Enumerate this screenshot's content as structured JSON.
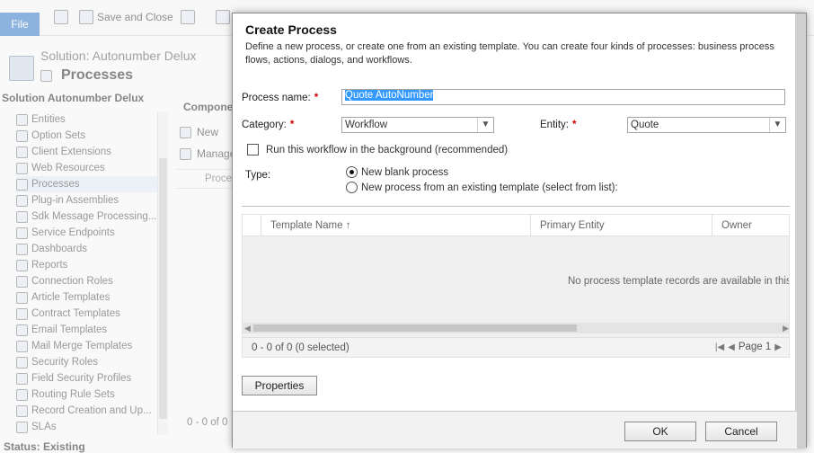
{
  "ribbon": {
    "file_label": "File",
    "save_close_label": "Save and Close"
  },
  "solution": {
    "title": "Solution: Autonumber Delux",
    "page_title": "Processes",
    "nav_heading": "Solution Autonumber Delux",
    "nav_items": [
      {
        "label": "Entities",
        "icon": "entities-icon"
      },
      {
        "label": "Option Sets",
        "icon": "option-sets-icon"
      },
      {
        "label": "Client Extensions",
        "icon": "client-extensions-icon"
      },
      {
        "label": "Web Resources",
        "icon": "web-resources-icon"
      },
      {
        "label": "Processes",
        "icon": "processes-icon",
        "selected": true
      },
      {
        "label": "Plug-in Assemblies",
        "icon": "plugin-icon"
      },
      {
        "label": "Sdk Message Processing...",
        "icon": "sdk-message-icon"
      },
      {
        "label": "Service Endpoints",
        "icon": "service-endpoint-icon"
      },
      {
        "label": "Dashboards",
        "icon": "dashboards-icon"
      },
      {
        "label": "Reports",
        "icon": "reports-icon"
      },
      {
        "label": "Connection Roles",
        "icon": "connection-roles-icon"
      },
      {
        "label": "Article Templates",
        "icon": "article-templates-icon"
      },
      {
        "label": "Contract Templates",
        "icon": "contract-templates-icon"
      },
      {
        "label": "Email Templates",
        "icon": "email-templates-icon"
      },
      {
        "label": "Mail Merge Templates",
        "icon": "mail-merge-icon"
      },
      {
        "label": "Security Roles",
        "icon": "security-roles-icon"
      },
      {
        "label": "Field Security Profiles",
        "icon": "field-security-icon"
      },
      {
        "label": "Routing Rule Sets",
        "icon": "routing-rule-icon"
      },
      {
        "label": "Record Creation and Up...",
        "icon": "record-creation-icon"
      },
      {
        "label": "SLAs",
        "icon": "sla-icon"
      }
    ],
    "components_heading": "Componer",
    "new_label": "New",
    "manage_label": "Manage",
    "column_label": "Proces",
    "count_text": "0 - 0 of 0",
    "status_text": "Status: Existing"
  },
  "dialog": {
    "title": "Create Process",
    "description": "Define a new process, or create one from an existing template. You can create four kinds of processes: business process flows, actions, dialogs, and workflows.",
    "process_name_label": "Process name:",
    "process_name_value": "Quote AutoNumber",
    "category_label": "Category:",
    "category_value": "Workflow",
    "entity_label": "Entity:",
    "entity_value": "Quote",
    "required_marker": "*",
    "background_checkbox_label": "Run this workflow in the background (recommended)",
    "background_checked": false,
    "type_label": "Type:",
    "type_options": [
      {
        "label": "New blank process",
        "selected": true
      },
      {
        "label": "New process from an existing template (select from list):",
        "selected": false
      }
    ],
    "grid": {
      "columns": [
        "Template Name",
        "Primary Entity",
        "Owner"
      ],
      "sort_indicator": "↑",
      "empty_message": "No process template records are available in this vi",
      "count_text": "0 - 0 of 0 (0 selected)",
      "page_label": "Page 1"
    },
    "properties_label": "Properties",
    "ok_label": "OK",
    "cancel_label": "Cancel"
  }
}
